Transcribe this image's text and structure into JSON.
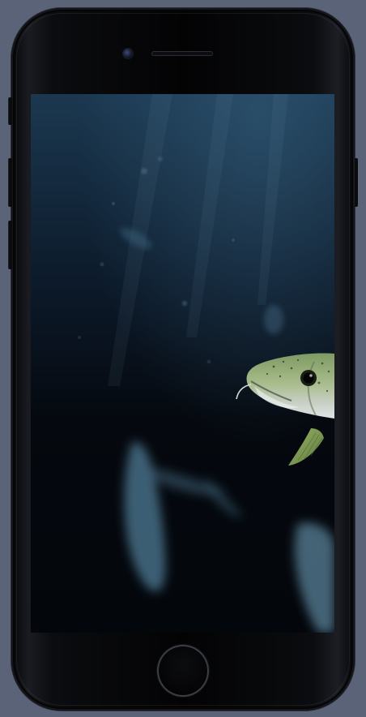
{
  "device": {
    "model": "smartphone",
    "body_color": "#050608",
    "background_color": "#5b6378"
  },
  "screen": {
    "content": "underwater-fish-photo",
    "water_color_top": "#1b3850",
    "water_color_bottom": "#03070c",
    "fish_color": "#8fae7a"
  }
}
